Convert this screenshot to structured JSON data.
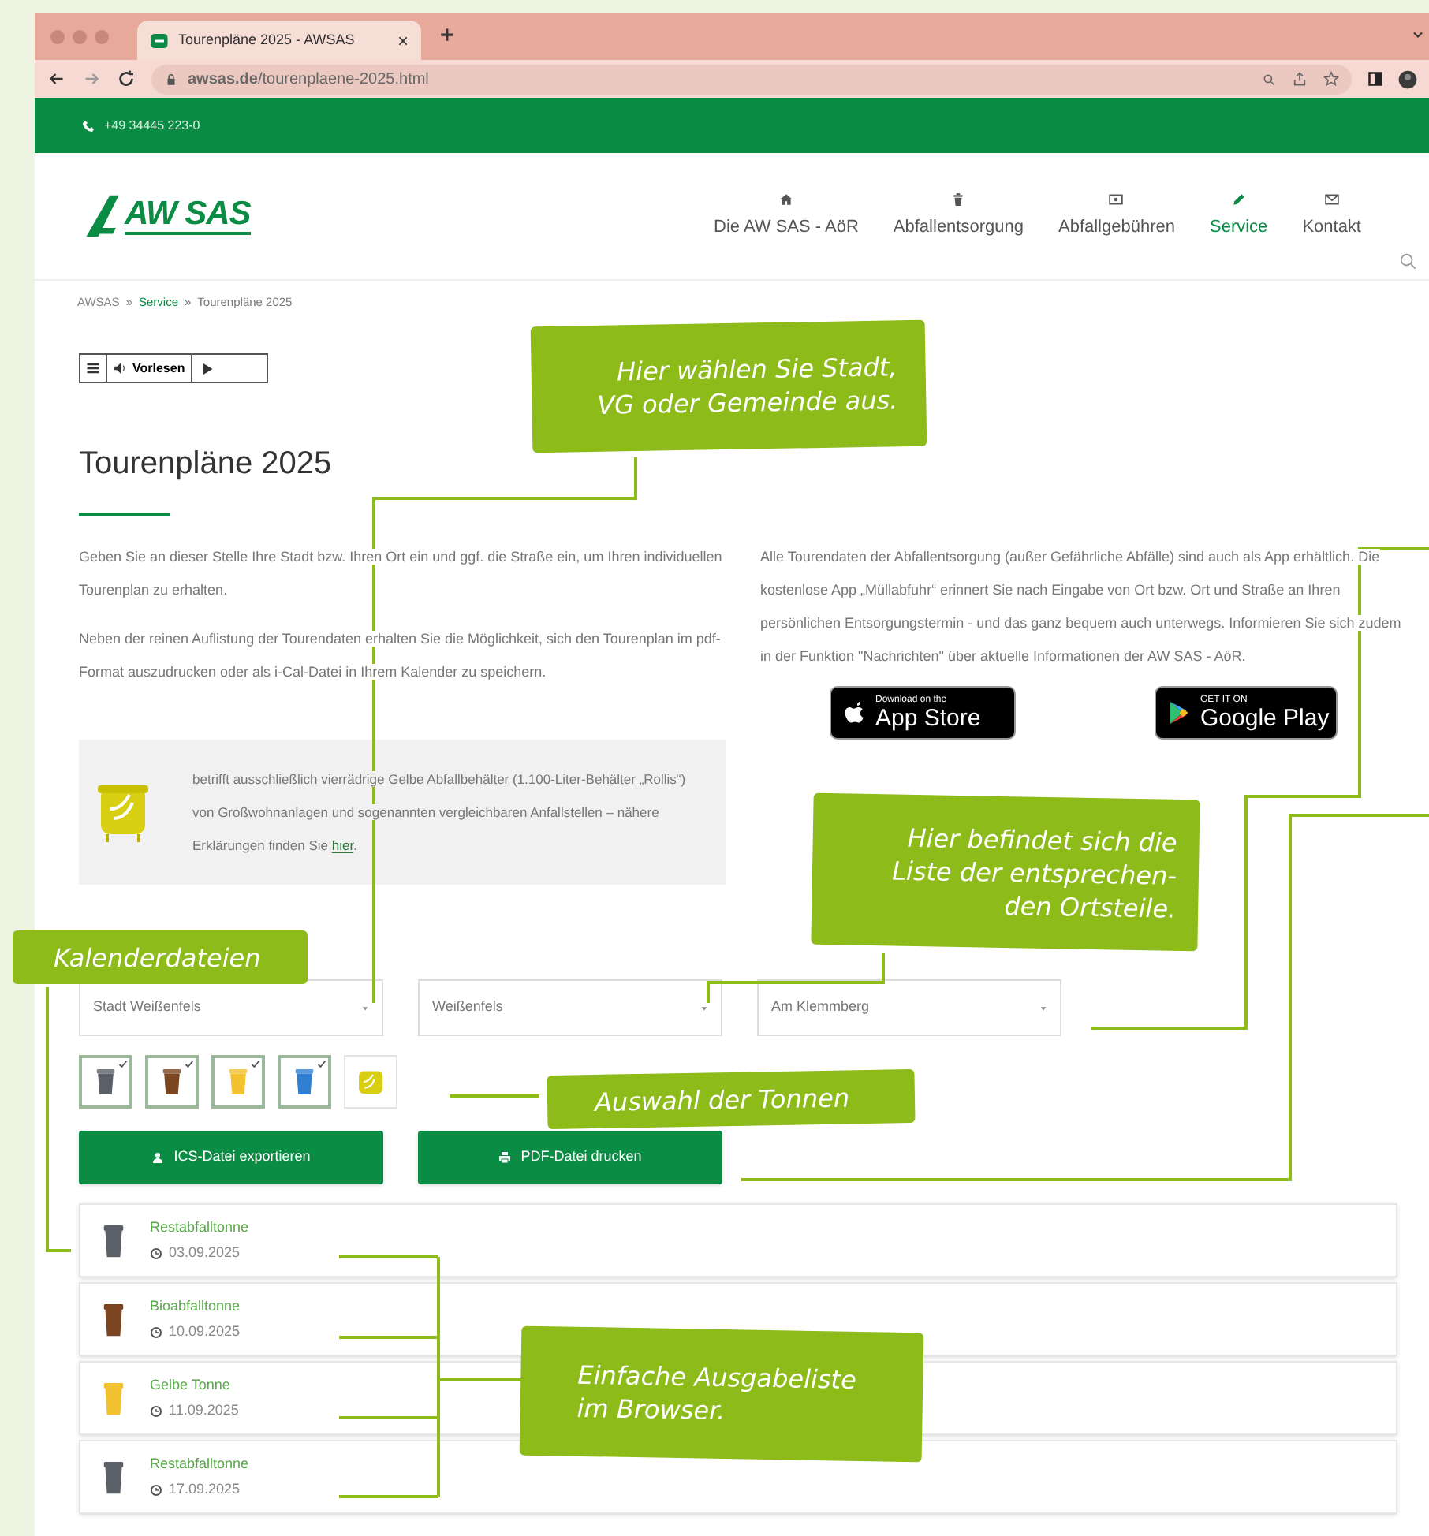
{
  "browser": {
    "tab_title": "Tourenpläne 2025 - AWSAS",
    "tab_close": "×",
    "new_tab": "+",
    "url": "**awsas.de**/tourenplaene-2025.html"
  },
  "topbar": {
    "phone": "+49 34445 223-0"
  },
  "header": {
    "logo": "AW SAS",
    "nav": [
      {
        "label": "Die AW SAS - AöR",
        "selected": false
      },
      {
        "label": "Abfallentsorgung",
        "selected": false
      },
      {
        "label": "Abfallgebühren",
        "selected": false
      },
      {
        "label": "Service",
        "selected": true
      },
      {
        "label": "Kontakt",
        "selected": false
      }
    ]
  },
  "breadcrumb": {
    "separator": "»",
    "items": [
      {
        "label": "AWSAS",
        "kind": "link"
      },
      {
        "label": "Service",
        "kind": "active"
      },
      {
        "label": "Tourenpläne 2025",
        "kind": "current"
      }
    ]
  },
  "reader": {
    "label": "Vorlesen"
  },
  "title": "Tourenpläne 2025",
  "intro_left": [
    "Geben Sie an dieser Stelle Ihre Stadt bzw. Ihren Ort ein und ggf. die Straße ein, um Ihren individuellen Tourenplan zu erhalten.",
    "Neben der reinen Auflistung der Tourendaten erhalten Sie die Möglichkeit, sich den Tourenplan im pdf-Format auszudrucken oder als i-Cal-Datei in Ihrem Kalender zu speichern."
  ],
  "notice": {
    "text": "betrifft ausschließlich vierrädrige Gelbe Abfallbehälter (1.100-Liter-Behälter „Rollis“) von Großwohnanlagen und sogenannten vergleichbaren Anfallstellen – nähere Erklärungen finden Sie ",
    "link": "hier",
    "end": "."
  },
  "intro_right": "Alle Tourendaten der Abfallentsorgung (außer Gefährliche Abfälle) sind auch als App erhältlich. Die kostenlose App „Müllabfuhr“ erinnert Sie nach Eingabe von Ort bzw. Ort und Straße an Ihren persönlichen Entsorgungstermin - und das ganz bequem auch unterwegs. Informieren Sie sich zudem in der Funktion \"Nachrichten\" über aktuelle Informationen der AW SAS - AöR.",
  "store_badges": [
    {
      "small": "Download on the",
      "big": "App Store"
    },
    {
      "small": "GET IT ON",
      "big": "Google Play"
    }
  ],
  "selects": [
    {
      "value": "Stadt Weißenfels"
    },
    {
      "value": "Weißenfels"
    },
    {
      "value": "Am Klemmberg"
    }
  ],
  "bins": [
    {
      "kind": "bin",
      "color": "#5b6068",
      "selected": true
    },
    {
      "kind": "bin",
      "color": "#7a4520",
      "selected": true
    },
    {
      "kind": "bin",
      "color": "#f2c230",
      "selected": true
    },
    {
      "kind": "bin",
      "color": "#2f7fd2",
      "selected": true
    },
    {
      "kind": "container",
      "color": "#d9cf12",
      "selected": false
    }
  ],
  "buttons": [
    {
      "label": "ICS-Datei exportieren"
    },
    {
      "label": "PDF-Datei drucken"
    }
  ],
  "results": [
    {
      "name": "Restabfalltonne",
      "date": "03.09.2025",
      "color": "#5b6068"
    },
    {
      "name": "Bioabfalltonne",
      "date": "10.09.2025",
      "color": "#7a4520"
    },
    {
      "name": "Gelbe Tonne",
      "date": "11.09.2025",
      "color": "#f2c230"
    },
    {
      "name": "Restabfalltonne",
      "date": "17.09.2025",
      "color": "#5b6068"
    }
  ],
  "annotations": [
    {
      "lines": [
        "Hier wählen Sie Stadt,",
        "VG oder Gemeinde aus."
      ]
    },
    {
      "lines": [
        "Hier befindet sich die",
        "Liste der entsprechen-",
        "den Ortsteile."
      ]
    },
    {
      "lines": [
        "Kalenderdateien"
      ]
    },
    {
      "lines": [
        "Auswahl der Tonnen"
      ]
    },
    {
      "lines": [
        "Einfache Ausgabeliste",
        "im Browser."
      ]
    }
  ]
}
